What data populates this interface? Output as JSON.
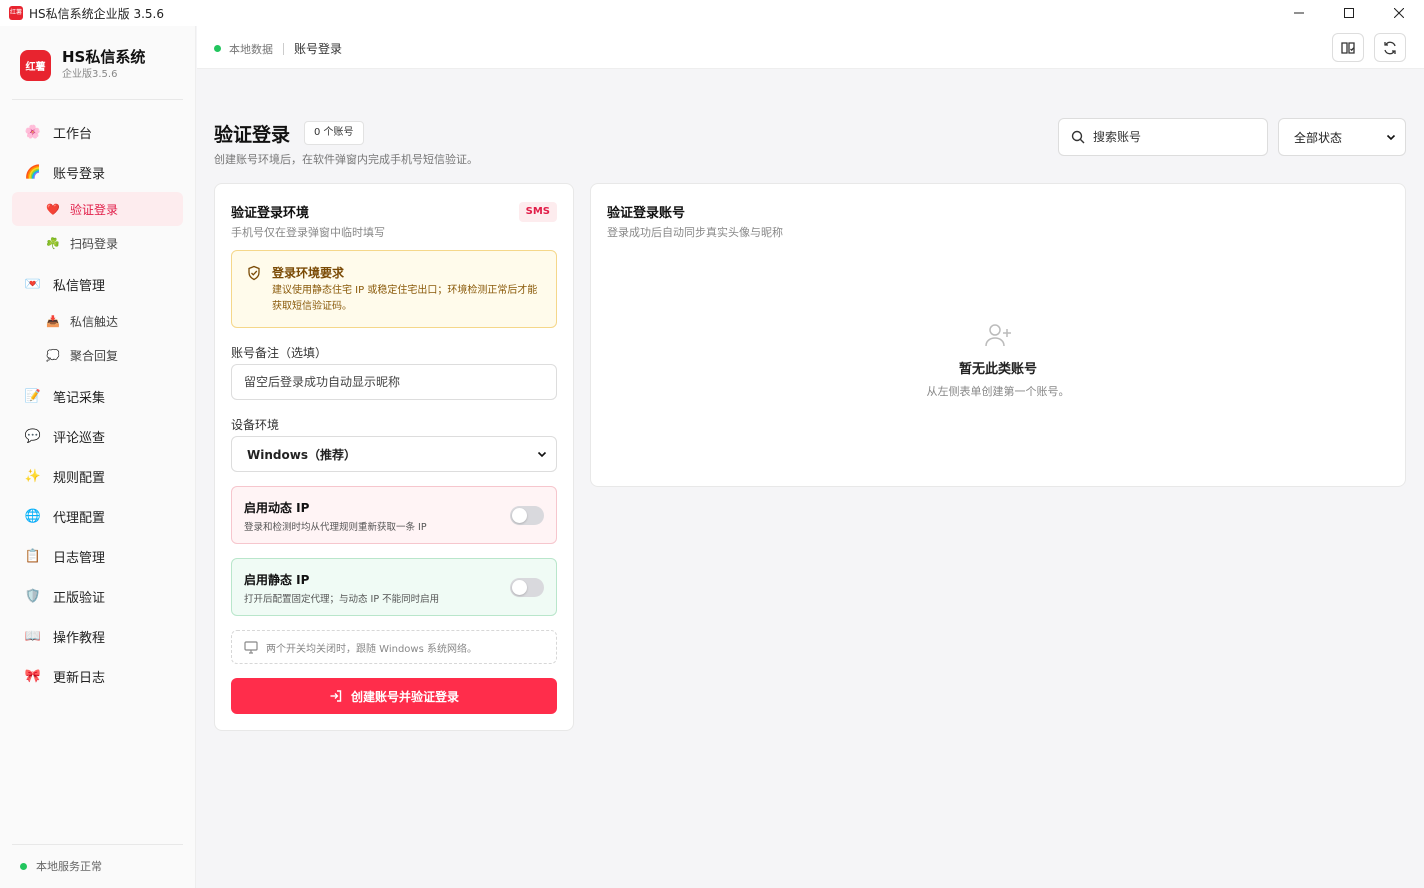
{
  "window": {
    "title": "HS私信系统企业版 3.5.6",
    "app_icon_text": "红薯"
  },
  "brand": {
    "logo_text": "红薯",
    "name": "HS私信系统",
    "version": "企业版3.5.6"
  },
  "sidebar": {
    "items": [
      {
        "label": "工作台",
        "icon": "cherry-blossom-icon"
      },
      {
        "label": "账号登录",
        "icon": "rainbow-icon"
      },
      {
        "label": "私信管理",
        "icon": "heart-letter-icon"
      },
      {
        "label": "笔记采集",
        "icon": "memo-icon"
      },
      {
        "label": "评论巡查",
        "icon": "speech-bubble-icon"
      },
      {
        "label": "规则配置",
        "icon": "sparkles-icon"
      },
      {
        "label": "代理配置",
        "icon": "globe-icon"
      },
      {
        "label": "日志管理",
        "icon": "clipboard-icon"
      },
      {
        "label": "正版验证",
        "icon": "shield-icon"
      },
      {
        "label": "操作教程",
        "icon": "book-icon"
      },
      {
        "label": "更新日志",
        "icon": "ribbon-icon"
      }
    ],
    "account_sub": [
      {
        "label": "验证登录",
        "icon": "heart-icon",
        "active": true
      },
      {
        "label": "扫码登录",
        "icon": "clover-icon",
        "active": false
      }
    ],
    "message_sub": [
      {
        "label": "私信触达",
        "icon": "inbox-icon"
      },
      {
        "label": "聚合回复",
        "icon": "chat-bubble-icon"
      }
    ],
    "footer_status": "本地服务正常"
  },
  "breadcrumb": {
    "root": "本地数据",
    "current": "账号登录"
  },
  "page": {
    "title": "验证登录",
    "count_badge": "0 个账号",
    "description": "创建账号环境后，在软件弹窗内完成手机号短信验证。",
    "search_placeholder": "搜索账号",
    "status_filter": "全部状态"
  },
  "form": {
    "title": "验证登录环境",
    "subtitle": "手机号仅在登录弹窗中临时填写",
    "tag": "SMS",
    "warning_title": "登录环境要求",
    "warning_text": "建议使用静态住宅 IP 或稳定住宅出口；环境检测正常后才能获取短信验证码。",
    "note_label": "账号备注（选填）",
    "note_placeholder": "留空后登录成功自动显示昵称",
    "device_label": "设备环境",
    "device_value": "Windows（推荐）",
    "dynamic_ip_title": "启用动态 IP",
    "dynamic_ip_desc": "登录和检测时均从代理规则重新获取一条 IP",
    "dynamic_ip_on": false,
    "static_ip_title": "启用静态 IP",
    "static_ip_desc": "打开后配置固定代理；与动态 IP 不能同时启用",
    "static_ip_on": false,
    "hint": "两个开关均关闭时，跟随 Windows 系统网络。",
    "submit_label": "创建账号并验证登录"
  },
  "accounts": {
    "title": "验证登录账号",
    "subtitle": "登录成功后自动同步真实头像与昵称",
    "empty_title": "暂无此类账号",
    "empty_sub": "从左侧表单创建第一个账号。"
  },
  "colors": {
    "brand_red": "#e8242f",
    "primary_button": "#ff2d4b",
    "status_green": "#22c55e"
  }
}
